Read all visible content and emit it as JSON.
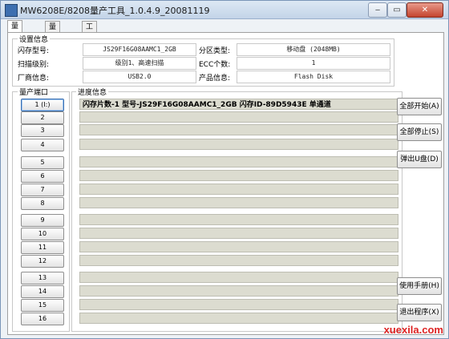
{
  "window": {
    "title": "MW6208E/8208量产工具_1.0.4.9_20081119"
  },
  "tabs": [
    "量产进度",
    "量产设置",
    "工厂设置"
  ],
  "settings": {
    "group_title": "设置信息",
    "fields": [
      {
        "label": "闪存型号:",
        "value": "JS29F16G08AAMC1_2GB"
      },
      {
        "label": "分区类型:",
        "value": "移动盘 (2048MB)"
      },
      {
        "label": "扫描级别:",
        "value": "级别1、高速扫描"
      },
      {
        "label": "ECC个数:",
        "value": "1"
      },
      {
        "label": "厂商信息:",
        "value": "USB2.0"
      },
      {
        "label": "产品信息:",
        "value": "Flash Disk"
      }
    ]
  },
  "ports": {
    "title": "量产端口",
    "buttons": [
      "1 (I:)",
      "2",
      "3",
      "4",
      "5",
      "6",
      "7",
      "8",
      "9",
      "10",
      "11",
      "12",
      "13",
      "14",
      "15",
      "16"
    ]
  },
  "progress": {
    "title": "进度信息",
    "rows": [
      "闪存片数-1 型号-JS29F16G08AAMC1_2GB 闪存ID-89D5943E 单通道",
      "",
      "",
      "",
      "",
      "",
      "",
      "",
      "",
      "",
      "",
      "",
      "",
      "",
      "",
      ""
    ]
  },
  "actions": {
    "start_all": "全部开始(A)",
    "stop_all": "全部停止(S)",
    "eject": "弹出U盘(D)",
    "manual": "使用手册(H)",
    "exit": "退出程序(X)"
  },
  "watermark": "xuexila.com"
}
